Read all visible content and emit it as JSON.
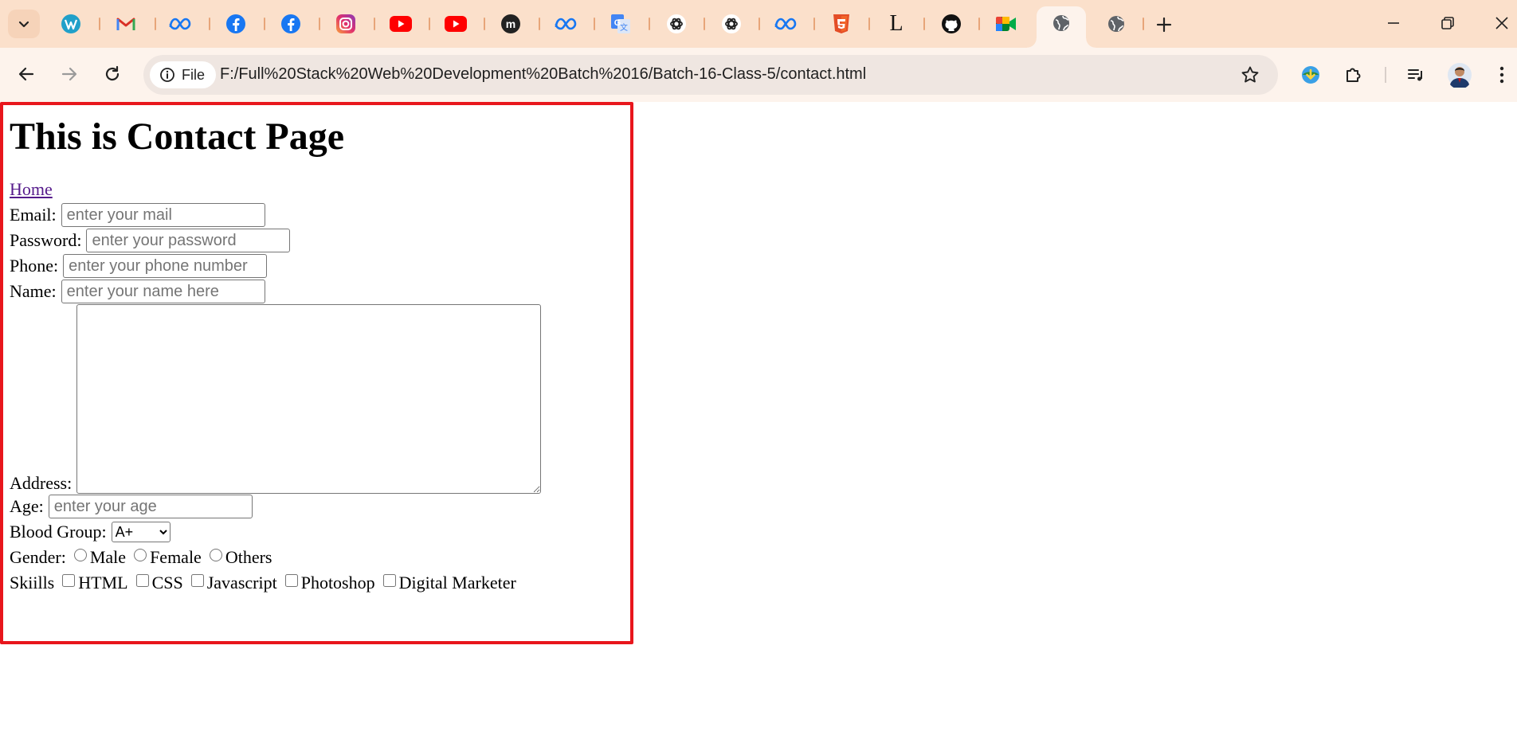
{
  "browser": {
    "tabs": [
      {
        "icon": "wordpress-icon",
        "color": "#21a0c9"
      },
      {
        "icon": "gmail-icon",
        "color": "#d93025"
      },
      {
        "icon": "meta-icon",
        "color": "#1877f2"
      },
      {
        "icon": "facebook-icon",
        "color": "#1877f2"
      },
      {
        "icon": "facebook-icon",
        "color": "#1877f2"
      },
      {
        "icon": "instagram-icon",
        "color": "#e1306c"
      },
      {
        "icon": "youtube-icon",
        "color": "#ff0000"
      },
      {
        "icon": "youtube-icon",
        "color": "#ff0000"
      },
      {
        "icon": "medium-icon",
        "color": "#222222"
      },
      {
        "icon": "meta-icon",
        "color": "#1877f2"
      },
      {
        "icon": "google-translate-icon",
        "color": "#4285f4"
      },
      {
        "icon": "chatgpt-icon",
        "color": "#222222"
      },
      {
        "icon": "chatgpt-icon",
        "color": "#222222"
      },
      {
        "icon": "meta-icon",
        "color": "#1877f2"
      },
      {
        "icon": "html5-icon",
        "color": "#e44d26"
      },
      {
        "icon": "l-letter-icon",
        "color": "#111111"
      },
      {
        "icon": "github-icon",
        "color": "#111111"
      },
      {
        "icon": "google-meet-icon",
        "color": "#00832d"
      },
      {
        "icon": "globe-icon",
        "color": "#5f6368",
        "active": true
      },
      {
        "icon": "globe-icon",
        "color": "#5f6368"
      }
    ],
    "l_letter": "L",
    "address_chip_label": "File",
    "url": "F:/Full%20Stack%20Web%20Development%20Batch%2016/Batch-16-Class-5/contact.html",
    "accent_border": "#e8161c"
  },
  "page": {
    "title": "This is Contact Page",
    "home_link": "Home",
    "email": {
      "label": "Email:",
      "placeholder": "enter your mail"
    },
    "password": {
      "label": "Password:",
      "placeholder": "enter your password"
    },
    "phone": {
      "label": "Phone:",
      "placeholder": "enter your phone number"
    },
    "name": {
      "label": "Name:",
      "placeholder": "enter your name here"
    },
    "address": {
      "label": "Address:"
    },
    "age": {
      "label": "Age:",
      "placeholder": "enter your age"
    },
    "blood_group": {
      "label": "Blood Group:",
      "selected": "A+"
    },
    "gender": {
      "label": "Gender:",
      "options": [
        "Male",
        "Female",
        "Others"
      ]
    },
    "skills": {
      "label": "Skiills",
      "options": [
        "HTML",
        "CSS",
        "Javascript",
        "Photoshop",
        "Digital Marketer"
      ]
    }
  }
}
